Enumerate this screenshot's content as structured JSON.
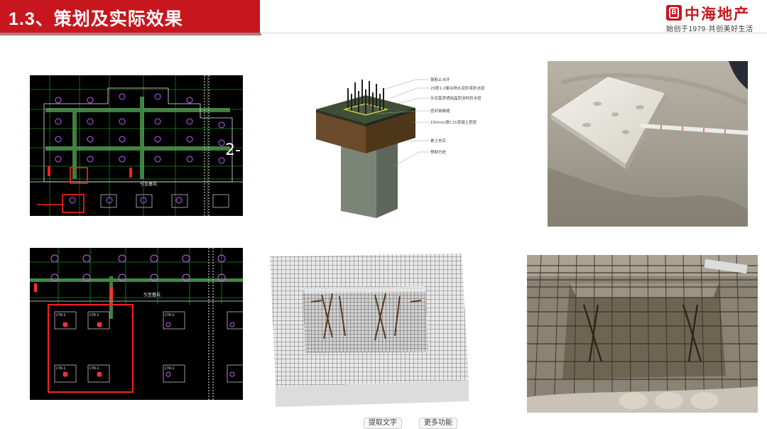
{
  "header": {
    "title": "1.3、策划及实际效果",
    "brand_mark": "B",
    "brand_name": "中海地产",
    "slogan": "始创于1979·共创美好生活",
    "accent_color": "#c8161e"
  },
  "diagram": {
    "labels": [
      "钢筋止水环",
      "20厚1:2聚合物水泥砂浆防水层",
      "水泥基渗透结晶型涂料防水层",
      "密封膏嵌缝",
      "150mm厚C15混凝土垫层",
      "素土夯实",
      "预制方桩"
    ]
  },
  "cad_top": {
    "label_large": "2-",
    "label_small": "引至基坑"
  },
  "cad_bottom": {
    "label_small": "引至基坑",
    "cap_labels": [
      "CTR-1",
      "CTR-1",
      "CTR-1",
      "CTR-1",
      "CTR-1",
      "CTR-1"
    ]
  },
  "buttons": {
    "left": "提取文字",
    "right": "更多功能"
  }
}
